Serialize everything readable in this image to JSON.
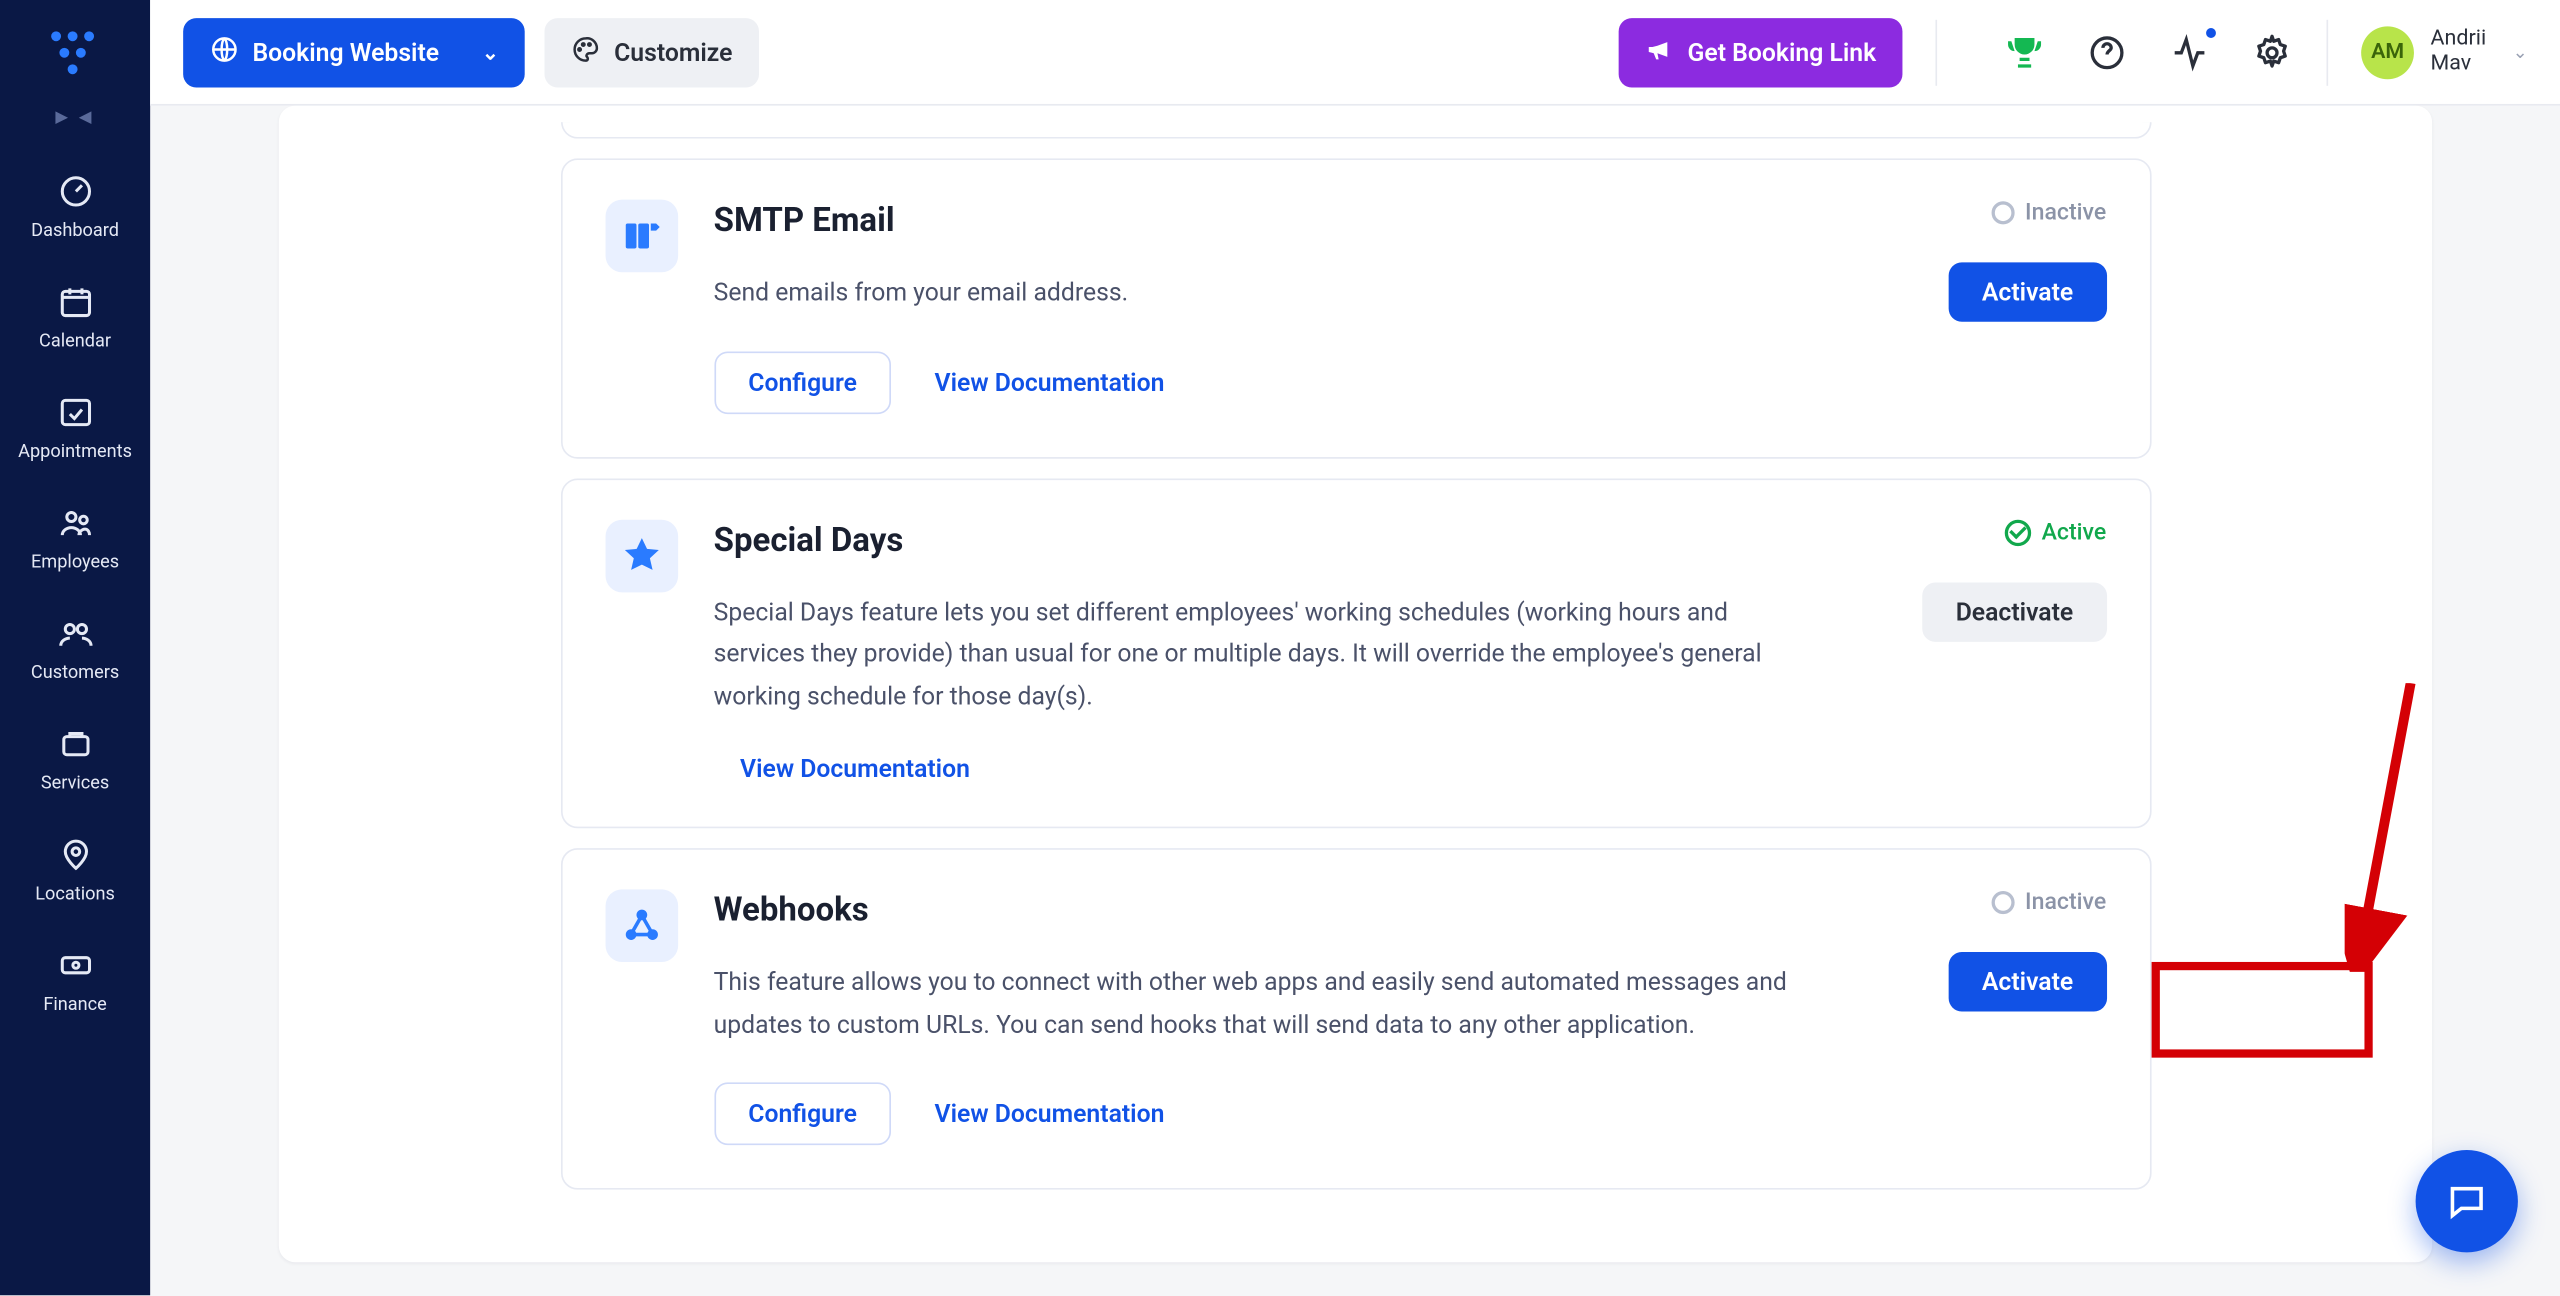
{
  "sidebar": {
    "items": [
      {
        "label": "Dashboard"
      },
      {
        "label": "Calendar"
      },
      {
        "label": "Appointments"
      },
      {
        "label": "Employees"
      },
      {
        "label": "Customers"
      },
      {
        "label": "Services"
      },
      {
        "label": "Locations"
      },
      {
        "label": "Finance"
      }
    ]
  },
  "topbar": {
    "booking_website": "Booking Website",
    "customize": "Customize",
    "get_booking_link": "Get Booking Link"
  },
  "user": {
    "initials": "AM",
    "name_line1": "Andrii",
    "name_line2": "Mav"
  },
  "features": {
    "smtp": {
      "title": "SMTP Email",
      "desc": "Send emails from your email address.",
      "status": "Inactive",
      "configure": "Configure",
      "docs": "View Documentation",
      "action": "Activate"
    },
    "special_days": {
      "title": "Special Days",
      "desc": "Special Days feature lets you set different employees' working schedules (working hours and services they provide) than usual for one or multiple days. It will override the employee's general working schedule for those day(s).",
      "status": "Active",
      "docs": "View Documentation",
      "action": "Deactivate"
    },
    "webhooks": {
      "title": "Webhooks",
      "desc": "This feature allows you to connect with other web apps and easily send automated messages and updates to custom URLs. You can send hooks that will send data to any other application.",
      "status": "Inactive",
      "configure": "Configure",
      "docs": "View Documentation",
      "action": "Activate"
    }
  }
}
